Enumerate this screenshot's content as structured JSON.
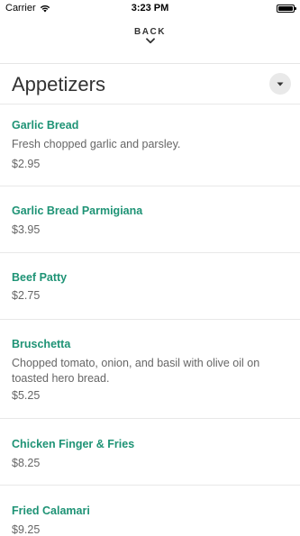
{
  "status": {
    "carrier": "Carrier",
    "time": "3:23 PM"
  },
  "nav": {
    "back_label": "BACK"
  },
  "section": {
    "title": "Appetizers"
  },
  "items": [
    {
      "name": "Garlic Bread",
      "description": "Fresh chopped garlic and parsley.",
      "price": "$2.95"
    },
    {
      "name": "Garlic Bread Parmigiana",
      "description": "",
      "price": "$3.95"
    },
    {
      "name": "Beef Patty",
      "description": "",
      "price": "$2.75"
    },
    {
      "name": "Bruschetta",
      "description": "Chopped tomato, onion, and basil with olive oil on toasted hero bread.",
      "price": "$5.25"
    },
    {
      "name": "Chicken Finger & Fries",
      "description": "",
      "price": "$8.25"
    },
    {
      "name": "Fried Calamari",
      "description": "",
      "price": "$9.25"
    }
  ],
  "colors": {
    "accent": "#1e9375",
    "text_secondary": "#666666",
    "divider": "#e8e8e8"
  }
}
